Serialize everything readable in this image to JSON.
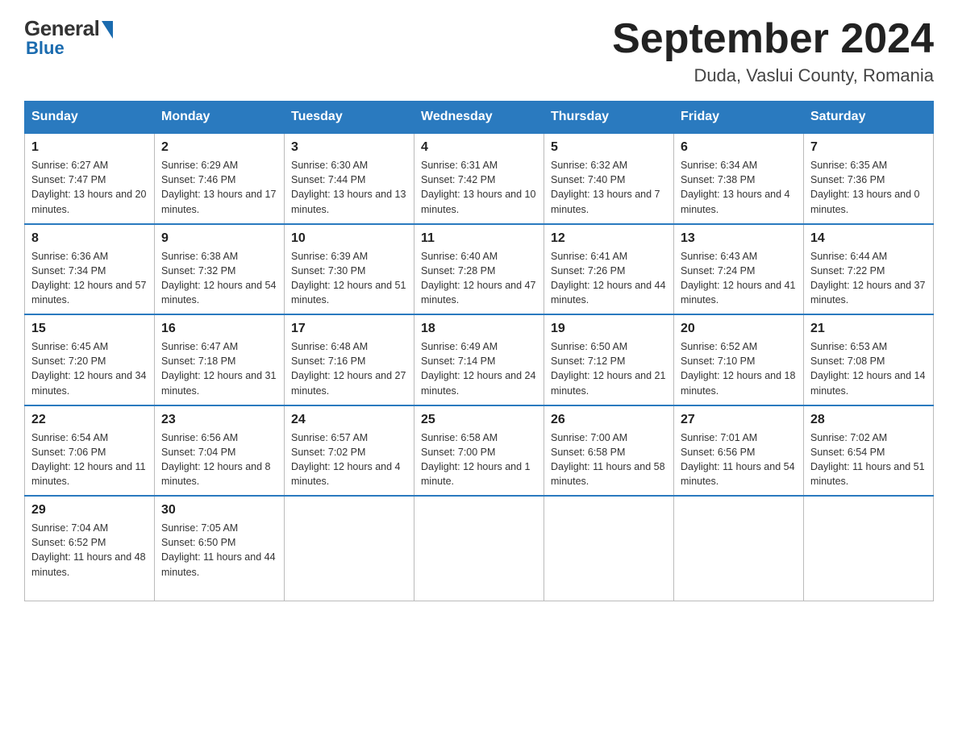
{
  "logo": {
    "general": "General",
    "blue": "Blue"
  },
  "title": "September 2024",
  "subtitle": "Duda, Vaslui County, Romania",
  "headers": [
    "Sunday",
    "Monday",
    "Tuesday",
    "Wednesday",
    "Thursday",
    "Friday",
    "Saturday"
  ],
  "weeks": [
    [
      {
        "day": "1",
        "sunrise": "6:27 AM",
        "sunset": "7:47 PM",
        "daylight": "13 hours and 20 minutes."
      },
      {
        "day": "2",
        "sunrise": "6:29 AM",
        "sunset": "7:46 PM",
        "daylight": "13 hours and 17 minutes."
      },
      {
        "day": "3",
        "sunrise": "6:30 AM",
        "sunset": "7:44 PM",
        "daylight": "13 hours and 13 minutes."
      },
      {
        "day": "4",
        "sunrise": "6:31 AM",
        "sunset": "7:42 PM",
        "daylight": "13 hours and 10 minutes."
      },
      {
        "day": "5",
        "sunrise": "6:32 AM",
        "sunset": "7:40 PM",
        "daylight": "13 hours and 7 minutes."
      },
      {
        "day": "6",
        "sunrise": "6:34 AM",
        "sunset": "7:38 PM",
        "daylight": "13 hours and 4 minutes."
      },
      {
        "day": "7",
        "sunrise": "6:35 AM",
        "sunset": "7:36 PM",
        "daylight": "13 hours and 0 minutes."
      }
    ],
    [
      {
        "day": "8",
        "sunrise": "6:36 AM",
        "sunset": "7:34 PM",
        "daylight": "12 hours and 57 minutes."
      },
      {
        "day": "9",
        "sunrise": "6:38 AM",
        "sunset": "7:32 PM",
        "daylight": "12 hours and 54 minutes."
      },
      {
        "day": "10",
        "sunrise": "6:39 AM",
        "sunset": "7:30 PM",
        "daylight": "12 hours and 51 minutes."
      },
      {
        "day": "11",
        "sunrise": "6:40 AM",
        "sunset": "7:28 PM",
        "daylight": "12 hours and 47 minutes."
      },
      {
        "day": "12",
        "sunrise": "6:41 AM",
        "sunset": "7:26 PM",
        "daylight": "12 hours and 44 minutes."
      },
      {
        "day": "13",
        "sunrise": "6:43 AM",
        "sunset": "7:24 PM",
        "daylight": "12 hours and 41 minutes."
      },
      {
        "day": "14",
        "sunrise": "6:44 AM",
        "sunset": "7:22 PM",
        "daylight": "12 hours and 37 minutes."
      }
    ],
    [
      {
        "day": "15",
        "sunrise": "6:45 AM",
        "sunset": "7:20 PM",
        "daylight": "12 hours and 34 minutes."
      },
      {
        "day": "16",
        "sunrise": "6:47 AM",
        "sunset": "7:18 PM",
        "daylight": "12 hours and 31 minutes."
      },
      {
        "day": "17",
        "sunrise": "6:48 AM",
        "sunset": "7:16 PM",
        "daylight": "12 hours and 27 minutes."
      },
      {
        "day": "18",
        "sunrise": "6:49 AM",
        "sunset": "7:14 PM",
        "daylight": "12 hours and 24 minutes."
      },
      {
        "day": "19",
        "sunrise": "6:50 AM",
        "sunset": "7:12 PM",
        "daylight": "12 hours and 21 minutes."
      },
      {
        "day": "20",
        "sunrise": "6:52 AM",
        "sunset": "7:10 PM",
        "daylight": "12 hours and 18 minutes."
      },
      {
        "day": "21",
        "sunrise": "6:53 AM",
        "sunset": "7:08 PM",
        "daylight": "12 hours and 14 minutes."
      }
    ],
    [
      {
        "day": "22",
        "sunrise": "6:54 AM",
        "sunset": "7:06 PM",
        "daylight": "12 hours and 11 minutes."
      },
      {
        "day": "23",
        "sunrise": "6:56 AM",
        "sunset": "7:04 PM",
        "daylight": "12 hours and 8 minutes."
      },
      {
        "day": "24",
        "sunrise": "6:57 AM",
        "sunset": "7:02 PM",
        "daylight": "12 hours and 4 minutes."
      },
      {
        "day": "25",
        "sunrise": "6:58 AM",
        "sunset": "7:00 PM",
        "daylight": "12 hours and 1 minute."
      },
      {
        "day": "26",
        "sunrise": "7:00 AM",
        "sunset": "6:58 PM",
        "daylight": "11 hours and 58 minutes."
      },
      {
        "day": "27",
        "sunrise": "7:01 AM",
        "sunset": "6:56 PM",
        "daylight": "11 hours and 54 minutes."
      },
      {
        "day": "28",
        "sunrise": "7:02 AM",
        "sunset": "6:54 PM",
        "daylight": "11 hours and 51 minutes."
      }
    ],
    [
      {
        "day": "29",
        "sunrise": "7:04 AM",
        "sunset": "6:52 PM",
        "daylight": "11 hours and 48 minutes."
      },
      {
        "day": "30",
        "sunrise": "7:05 AM",
        "sunset": "6:50 PM",
        "daylight": "11 hours and 44 minutes."
      },
      null,
      null,
      null,
      null,
      null
    ]
  ],
  "labels": {
    "sunrise": "Sunrise:",
    "sunset": "Sunset:",
    "daylight": "Daylight:"
  }
}
